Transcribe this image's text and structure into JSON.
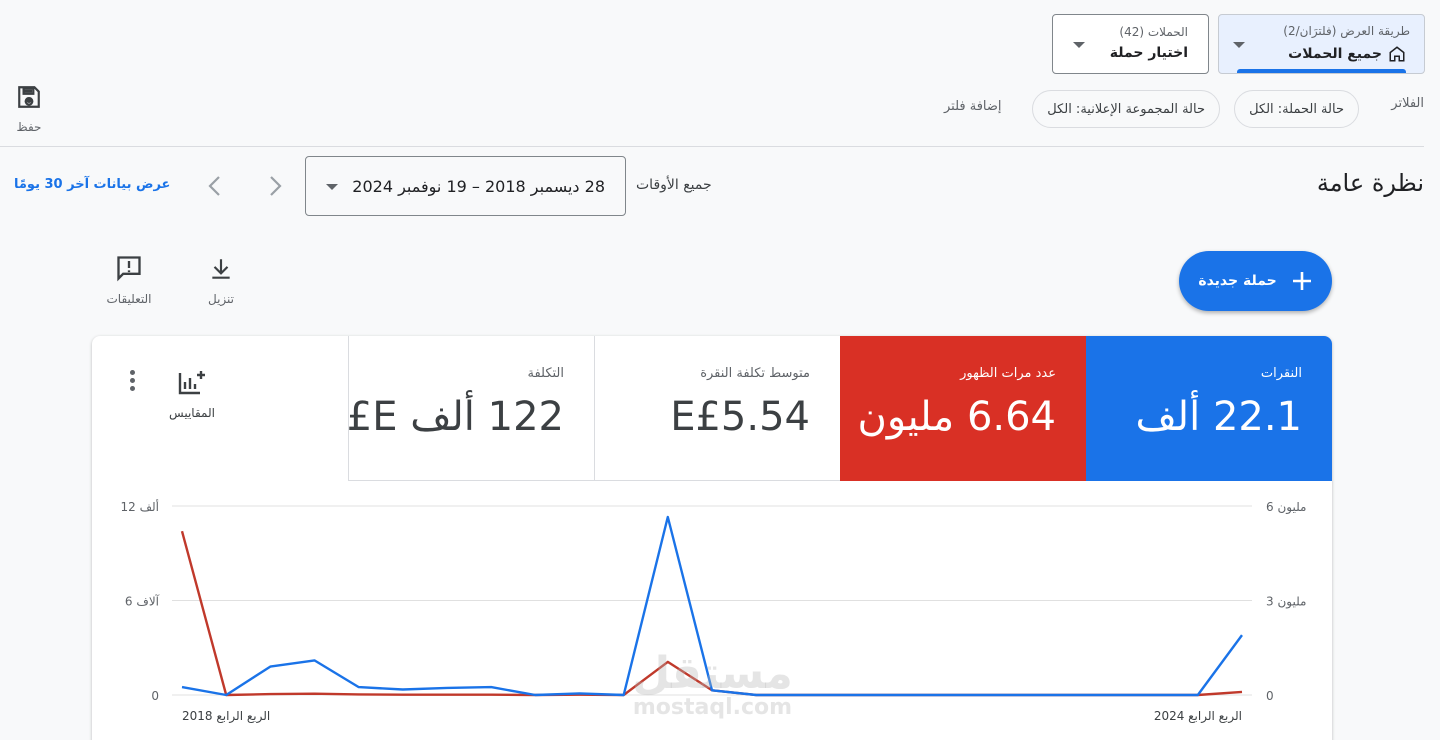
{
  "header": {
    "view_mode": {
      "label": "طريقة العرض (فلترَان/2)",
      "value": "جميع الحملات"
    },
    "campaign_picker": {
      "label": "الحملات (42)",
      "value": "اختيار حملة"
    },
    "save_label": "حفظ"
  },
  "filters": {
    "title": "الفلاتر",
    "chips": [
      "حالة الحملة: الكل",
      "حالة المجموعة الإعلانية: الكل"
    ],
    "add_filter": "إضافة فلتر"
  },
  "overview": {
    "title": "نظرة عامة",
    "range_label": "جميع الأوقات",
    "date_range": "28 ديسمبر 2018 – 19 نوفمبر 2024",
    "last30": "عرض بيانات آخر 30 يومًا"
  },
  "actions": {
    "new_campaign": "حملة جديدة",
    "download": "تنزيل",
    "feedback": "التعليقات"
  },
  "metrics": {
    "clicks": {
      "name": "النقرات",
      "value": "22.1 ألف",
      "color": "#1a73e8"
    },
    "impressions": {
      "name": "عدد مرات الظهور",
      "value": "6.64 مليون",
      "color": "#d93025"
    },
    "avg_cpc": {
      "name": "متوسط تكلفة النقرة",
      "value": "E£5.54"
    },
    "cost": {
      "name": "التكلفة",
      "value": "122 ألف E£"
    },
    "scales_label": "المقاييس"
  },
  "watermark": {
    "line1": "مستقل",
    "line2": "mostaql.com"
  },
  "chart_data": {
    "type": "line",
    "x_labels": [
      "الربع الرابع 2018",
      "الربع الرابع 2024"
    ],
    "y_left": {
      "ticks": [
        "0",
        "6 آلاف",
        "12 ألف"
      ],
      "ylim": [
        0,
        12000
      ]
    },
    "y_right": {
      "ticks": [
        "0",
        "3 مليون",
        "6 مليون"
      ],
      "ylim": [
        0,
        6000000
      ]
    },
    "grid": true,
    "series": [
      {
        "name": "النقرات",
        "axis": "left",
        "color": "#1a73e8",
        "values": [
          500,
          0,
          1800,
          2200,
          500,
          350,
          450,
          500,
          0,
          100,
          0,
          11300,
          300,
          0,
          0,
          0,
          0,
          0,
          0,
          0,
          0,
          0,
          0,
          0,
          3800
        ]
      },
      {
        "name": "عدد مرات الظهور",
        "axis": "right",
        "color": "#c0392b",
        "values": [
          5200000,
          0,
          30000,
          40000,
          20000,
          10000,
          10000,
          10000,
          0,
          10000,
          0,
          1050000,
          150000,
          0,
          0,
          0,
          0,
          0,
          0,
          0,
          0,
          0,
          0,
          0,
          100000
        ]
      }
    ]
  }
}
